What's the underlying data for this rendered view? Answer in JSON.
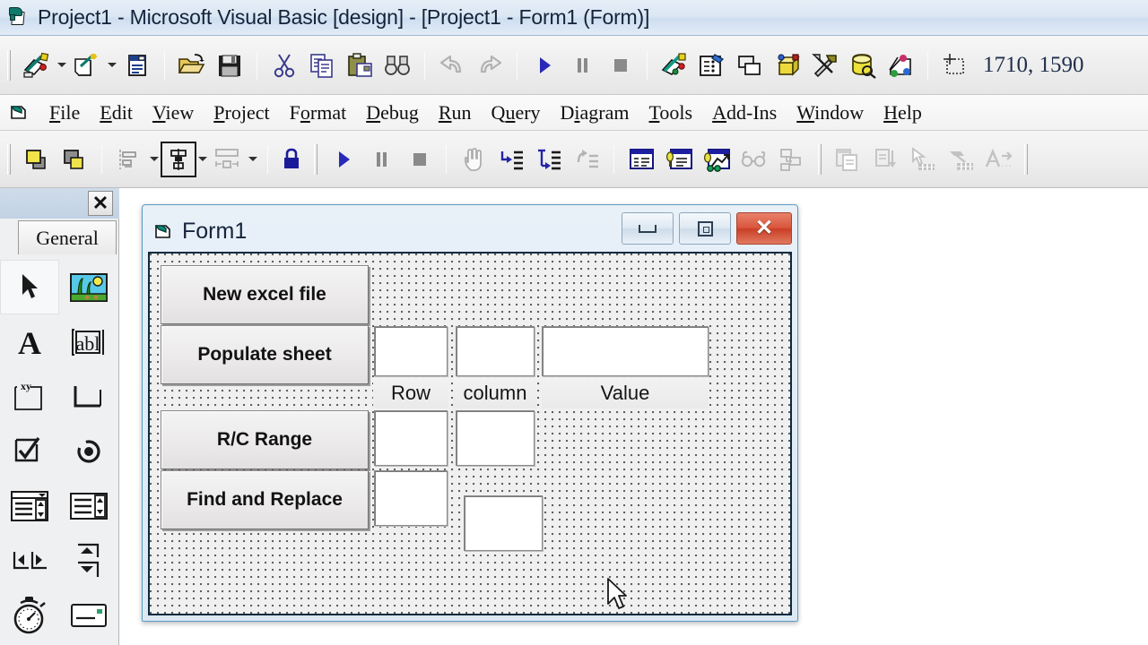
{
  "titlebar": {
    "icon": "vb-project-icon",
    "text": "Project1 - Microsoft Visual Basic [design] - [Project1 - Form1 (Form)]"
  },
  "toolbar_main": {
    "coordinates": "1710, 1590",
    "position_icon": "position-marker-icon",
    "buttons": [
      {
        "name": "add-project-button",
        "icon": "add-project-icon"
      },
      {
        "name": "add-project-dropdown",
        "icon": "chevron-down-icon"
      },
      {
        "name": "add-form-button",
        "icon": "add-form-icon"
      },
      {
        "name": "add-form-dropdown",
        "icon": "chevron-down-icon"
      },
      {
        "name": "menu-editor-button",
        "icon": "menu-editor-icon"
      },
      {
        "name": "open-project-button",
        "icon": "open-folder-icon"
      },
      {
        "name": "save-project-button",
        "icon": "floppy-save-icon"
      },
      {
        "name": "cut-button",
        "icon": "scissors-icon"
      },
      {
        "name": "copy-button",
        "icon": "copy-icon"
      },
      {
        "name": "paste-button",
        "icon": "clipboard-paste-icon"
      },
      {
        "name": "find-button",
        "icon": "binoculars-icon"
      },
      {
        "name": "undo-button",
        "icon": "undo-arrow-icon"
      },
      {
        "name": "redo-button",
        "icon": "redo-arrow-icon"
      },
      {
        "name": "start-button",
        "icon": "play-triangle-icon"
      },
      {
        "name": "break-button",
        "icon": "pause-icon"
      },
      {
        "name": "end-button",
        "icon": "stop-square-icon"
      },
      {
        "name": "project-explorer-button",
        "icon": "project-explorer-icon"
      },
      {
        "name": "properties-window-button",
        "icon": "properties-window-icon"
      },
      {
        "name": "form-layout-button",
        "icon": "form-layout-icon"
      },
      {
        "name": "object-browser-button",
        "icon": "object-browser-icon"
      },
      {
        "name": "toolbox-button",
        "icon": "toolbox-hammer-icon"
      },
      {
        "name": "data-view-button",
        "icon": "database-view-icon"
      },
      {
        "name": "component-manager-button",
        "icon": "component-manager-icon"
      }
    ]
  },
  "menubar": {
    "icon": "form-document-icon",
    "items": [
      {
        "name": "menu-file",
        "pre": "",
        "hot": "F",
        "post": "ile"
      },
      {
        "name": "menu-edit",
        "pre": "",
        "hot": "E",
        "post": "dit"
      },
      {
        "name": "menu-view",
        "pre": "",
        "hot": "V",
        "post": "iew"
      },
      {
        "name": "menu-project",
        "pre": "",
        "hot": "P",
        "post": "roject"
      },
      {
        "name": "menu-format",
        "pre": "F",
        "hot": "o",
        "post": "rmat"
      },
      {
        "name": "menu-debug",
        "pre": "",
        "hot": "D",
        "post": "ebug"
      },
      {
        "name": "menu-run",
        "pre": "",
        "hot": "R",
        "post": "un"
      },
      {
        "name": "menu-query",
        "pre": "Q",
        "hot": "u",
        "post": "ery"
      },
      {
        "name": "menu-diagram",
        "pre": "D",
        "hot": "i",
        "post": "agram"
      },
      {
        "name": "menu-tools",
        "pre": "",
        "hot": "T",
        "post": "ools"
      },
      {
        "name": "menu-addins",
        "pre": "",
        "hot": "A",
        "post": "dd-Ins"
      },
      {
        "name": "menu-window",
        "pre": "",
        "hot": "W",
        "post": "indow"
      },
      {
        "name": "menu-help",
        "pre": "",
        "hot": "H",
        "post": "elp"
      }
    ]
  },
  "toolbar_form": {
    "buttons": [
      {
        "name": "bring-to-front-button",
        "icon": "bring-to-front-icon"
      },
      {
        "name": "send-to-back-button",
        "icon": "send-to-back-icon"
      },
      {
        "name": "align-button",
        "icon": "align-left-icon"
      },
      {
        "name": "align-dropdown",
        "icon": "chevron-down-icon"
      },
      {
        "name": "center-button",
        "icon": "center-horizontally-icon"
      },
      {
        "name": "center-dropdown",
        "icon": "chevron-down-icon"
      },
      {
        "name": "size-button",
        "icon": "make-same-size-icon"
      },
      {
        "name": "size-dropdown",
        "icon": "chevron-down-icon"
      },
      {
        "name": "lock-controls-button",
        "icon": "padlock-icon"
      },
      {
        "name": "start-button",
        "icon": "play-triangle-icon"
      },
      {
        "name": "break-button",
        "icon": "pause-icon"
      },
      {
        "name": "end-button",
        "icon": "stop-square-icon"
      },
      {
        "name": "drag-hand-button",
        "icon": "hand-icon"
      },
      {
        "name": "step-into-button",
        "icon": "step-into-icon"
      },
      {
        "name": "step-over-button",
        "icon": "step-over-icon"
      },
      {
        "name": "step-out-button",
        "icon": "step-out-icon"
      },
      {
        "name": "locals-window-button",
        "icon": "locals-window-icon"
      },
      {
        "name": "immediate-window-button",
        "icon": "immediate-window-icon"
      },
      {
        "name": "watch-window-button",
        "icon": "watch-window-icon"
      },
      {
        "name": "quick-watch-button",
        "icon": "quick-watch-icon"
      },
      {
        "name": "call-stack-button",
        "icon": "call-stack-icon"
      },
      {
        "name": "copy-records-button",
        "icon": "copy-records-icon"
      },
      {
        "name": "sort-records-button",
        "icon": "sort-records-icon"
      },
      {
        "name": "select-grid-button",
        "icon": "select-grid-icon"
      },
      {
        "name": "fill-grid-button",
        "icon": "fill-grid-icon"
      },
      {
        "name": "add-text-button",
        "icon": "add-text-icon"
      }
    ]
  },
  "toolbox": {
    "close_label": "✕",
    "tab_label": "General",
    "tools": [
      {
        "name": "tool-pointer",
        "icon": "arrow-pointer-icon",
        "selected": true
      },
      {
        "name": "tool-picturebox",
        "icon": "picture-box-icon",
        "selected": false
      },
      {
        "name": "tool-label",
        "icon": "label-A-icon",
        "selected": false
      },
      {
        "name": "tool-textbox",
        "icon": "textbox-abl-icon",
        "selected": false
      },
      {
        "name": "tool-frame",
        "icon": "frame-xy-icon",
        "selected": false
      },
      {
        "name": "tool-commandbutton",
        "icon": "command-button-icon",
        "selected": false
      },
      {
        "name": "tool-checkbox",
        "icon": "checkbox-icon",
        "selected": false
      },
      {
        "name": "tool-optionbutton",
        "icon": "option-radio-icon",
        "selected": false
      },
      {
        "name": "tool-combobox",
        "icon": "combo-box-icon",
        "selected": false
      },
      {
        "name": "tool-listbox",
        "icon": "list-box-icon",
        "selected": false
      },
      {
        "name": "tool-hscrollbar",
        "icon": "hscrollbar-icon",
        "selected": false
      },
      {
        "name": "tool-vscrollbar",
        "icon": "vscrollbar-icon",
        "selected": false
      },
      {
        "name": "tool-timer",
        "icon": "stopwatch-timer-icon",
        "selected": false
      },
      {
        "name": "tool-drivelistbox",
        "icon": "drive-list-icon",
        "selected": false
      }
    ]
  },
  "form": {
    "icon": "form-document-icon",
    "title": "Form1",
    "minimize_label": "minimize",
    "maximize_label": "maximize",
    "close_label": "✕",
    "buttons": [
      {
        "name": "button-new-excel-file",
        "label": "New excel file"
      },
      {
        "name": "button-populate-sheet",
        "label": "Populate sheet"
      },
      {
        "name": "button-rc-range",
        "label": "R/C Range"
      },
      {
        "name": "button-find-and-replace",
        "label": "Find and Replace"
      }
    ],
    "labels": [
      {
        "name": "label-row",
        "text": "Row"
      },
      {
        "name": "label-column",
        "text": "column"
      },
      {
        "name": "label-value",
        "text": "Value"
      }
    ],
    "textboxes": [
      {
        "name": "textbox-populate-row",
        "value": ""
      },
      {
        "name": "textbox-populate-column",
        "value": ""
      },
      {
        "name": "textbox-populate-value",
        "value": ""
      },
      {
        "name": "textbox-range-row",
        "value": ""
      },
      {
        "name": "textbox-range-column",
        "value": ""
      },
      {
        "name": "textbox-find",
        "value": ""
      },
      {
        "name": "textbox-replace",
        "value": ""
      }
    ]
  },
  "cursor": {
    "name": "mouse-pointer",
    "icon": "arrow-cursor-icon"
  }
}
